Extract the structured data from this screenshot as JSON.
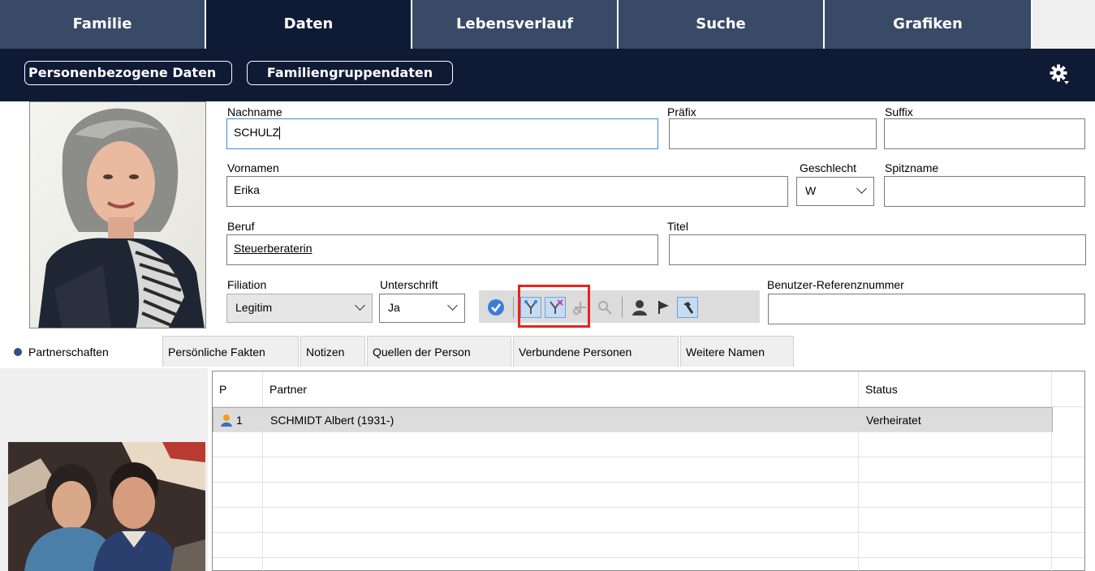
{
  "top_tabs": [
    {
      "label": "Familie"
    },
    {
      "label": "Daten"
    },
    {
      "label": "Lebensverlauf"
    },
    {
      "label": "Suche"
    },
    {
      "label": "Grafiken"
    }
  ],
  "active_top_tab": "Daten",
  "subbar": {
    "personal_button": "Personenbezogene Daten",
    "family_button": "Familiengruppendaten"
  },
  "form": {
    "nachname_label": "Nachname",
    "nachname_value": "SCHULZ",
    "praefix_label": "Präfix",
    "praefix_value": "",
    "suffix_label": "Suffix",
    "suffix_value": "",
    "vornamen_label": "Vornamen",
    "vornamen_value": "Erika",
    "geschlecht_label": "Geschlecht",
    "geschlecht_value": "W",
    "spitzname_label": "Spitzname",
    "spitzname_value": "",
    "beruf_label": "Beruf",
    "beruf_value": "Steuerberaterin",
    "titel_label": "Titel",
    "titel_value": "",
    "filiation_label": "Filiation",
    "filiation_value": "Legitim",
    "unterschrift_label": "Unterschrift",
    "unterschrift_value": "Ja",
    "referenz_label": "Benutzer-Referenznummer",
    "referenz_value": ""
  },
  "toolbar_icons": [
    "check-circle-icon",
    "link-partner-icon",
    "unlink-partner-icon",
    "cut-icon",
    "search-remove-icon",
    "person-icon",
    "flag-icon",
    "hammer-icon"
  ],
  "lower_tabs": [
    {
      "label": "Partnerschaften"
    },
    {
      "label": "Persönliche Fakten"
    },
    {
      "label": "Notizen"
    },
    {
      "label": "Quellen der Person"
    },
    {
      "label": "Verbundene Personen"
    },
    {
      "label": "Weitere Namen"
    }
  ],
  "partner_table": {
    "headers": {
      "p": "P",
      "partner": "Partner",
      "status": "Status"
    },
    "rows": [
      {
        "p": "1",
        "partner": "SCHMIDT Albert (1931-)",
        "status": "Verheiratet"
      }
    ]
  },
  "colors": {
    "tab_bg": "#394a66",
    "active_bg": "#0f1a35",
    "highlight_red": "#e8231d",
    "focus_blue": "#3b8ad9"
  }
}
